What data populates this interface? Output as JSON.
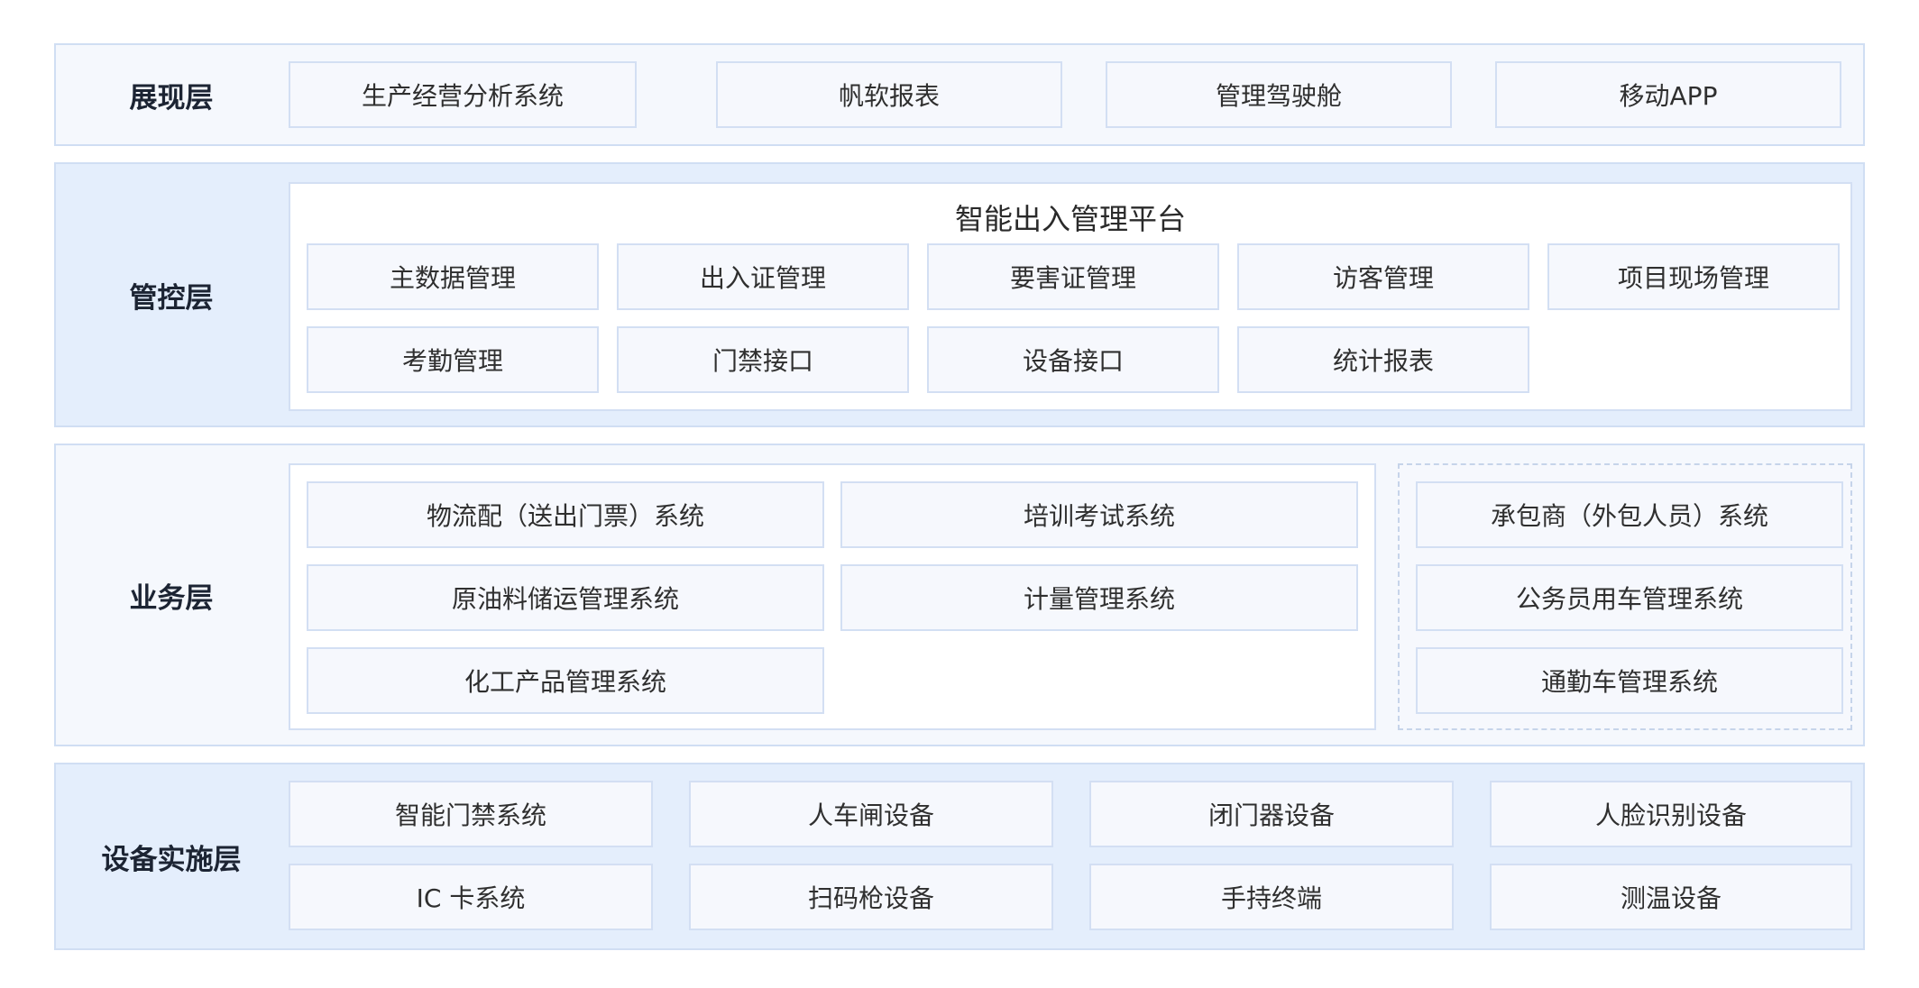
{
  "layers": {
    "presentation": {
      "label": "展现层",
      "items": [
        "生产经营分析系统",
        "帆软报表",
        "管理驾驶舱",
        "移动APP"
      ]
    },
    "control": {
      "label": "管控层",
      "platform_title": "智能出入管理平台",
      "items": [
        "主数据管理",
        "出入证管理",
        "要害证管理",
        "访客管理",
        "项目现场管理",
        "考勤管理",
        "门禁接口",
        "设备接口",
        "统计报表"
      ]
    },
    "business": {
      "label": "业务层",
      "internal_items": [
        "物流配（送出门票）系统",
        "培训考试系统",
        "原油料储运管理系统",
        "计量管理系统",
        "化工产品管理系统"
      ],
      "external_items": [
        "承包商（外包人员）系统",
        "公务员用车管理系统",
        "通勤车管理系统"
      ]
    },
    "device": {
      "label": "设备实施层",
      "items": [
        "智能门禁系统",
        "人车闸设备",
        "闭门器设备",
        "人脸识别设备",
        "IC 卡系统",
        "扫码枪设备",
        "手持终端",
        "测温设备"
      ]
    }
  },
  "colors": {
    "band_light": "#f5f8fd",
    "band_blue": "#e4eefc",
    "border": "#d3dff3",
    "box_fill": "#f6f8fd"
  }
}
